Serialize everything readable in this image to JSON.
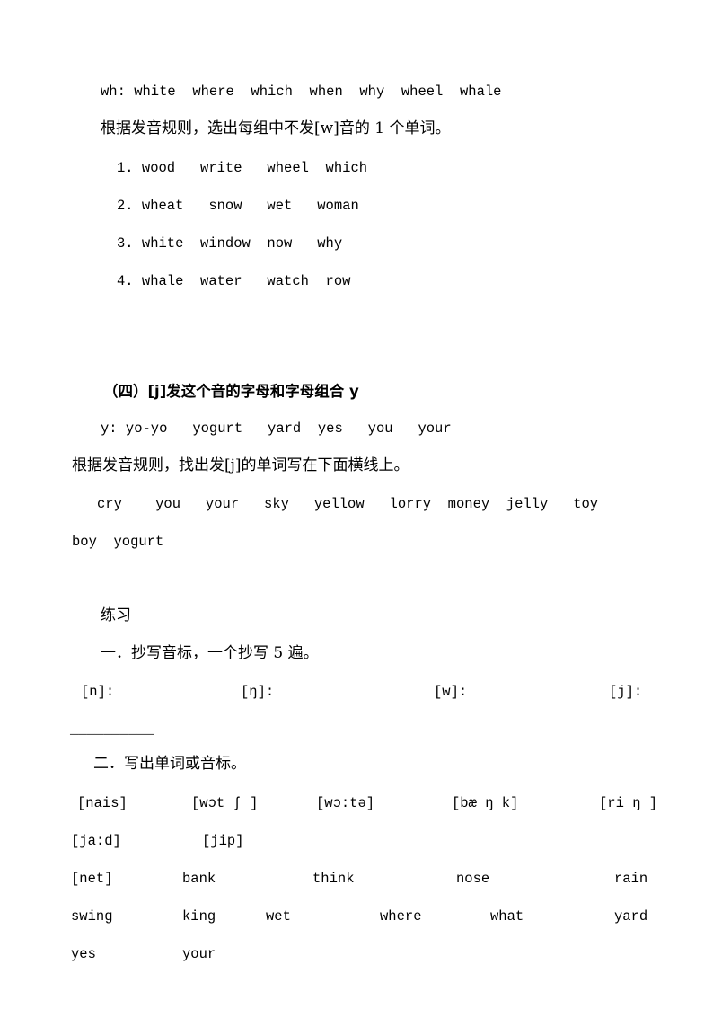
{
  "document": {
    "type": "phonics-worksheet-page",
    "background": "#ffffff",
    "text_color": "#000000"
  },
  "section_wh": {
    "example_line": "wh: white  where  which  when  why  wheel  whale",
    "instruction": "根据发音规则，选出每组中不发[w]音的 1 个单词。",
    "items": [
      "1. wood   write   wheel  which",
      "2. wheat   snow   wet   woman",
      "3. white  window  now   why",
      "4. whale  water   watch  row"
    ]
  },
  "section_j": {
    "heading": "（四）[j]发这个音的字母和字母组合 y",
    "example_line": "y: yo-yo   yogurt   yard  yes   you   your",
    "instruction": "根据发音规则，找出发[j]的单词写在下面横线上。",
    "word_bank_line1": "cry    you   your   sky   yellow   lorry  money  jelly   toy",
    "word_bank_line2": "boy  yogurt"
  },
  "exercises": {
    "heading": "练习",
    "ex1": {
      "title": "一．抄写音标，一个抄写 5 遍。",
      "symbols": [
        "[n]:",
        "[ŋ]:",
        "[w]:",
        "[j]:"
      ],
      "blank_rule": "__________"
    },
    "ex2": {
      "title": "二．写出单词或音标。",
      "phonetic_row1": [
        "[nais]",
        "[wɔt ʃ ]",
        "[wɔ:tə]",
        "[bæ ŋ k]",
        "[ri ŋ ]"
      ],
      "phonetic_row2": [
        "[ja:d]",
        "[jip]"
      ],
      "word_row1": [
        "[net]",
        "bank",
        "think",
        "nose",
        "rain"
      ],
      "word_row2": [
        "swing",
        "king",
        "wet",
        "where",
        "what",
        "yard"
      ],
      "word_row3": [
        "yes",
        "your"
      ]
    }
  }
}
